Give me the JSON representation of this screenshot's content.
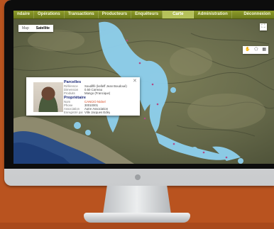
{
  "nav": {
    "items": [
      "ndaire",
      "Opérations",
      "Transactions",
      "Producteurs",
      "Enquêteurs",
      "Carte",
      "Administration"
    ],
    "active_index": 5,
    "logout": "Déconnexion"
  },
  "map_controls": {
    "map_label": "Map",
    "satellite_label": "Satellite",
    "selected": "Satellite",
    "fullscreen_icon": "fullscreen-icon",
    "tool_icons": [
      "pan-hand-icon",
      "polygon-draw-icon",
      "grid-icon"
    ]
  },
  "colors": {
    "nav_bg": "#7d8b23",
    "nav_active": "#b5c15a",
    "parcel_marker": "#8ed0ee",
    "info_title": "#1d2a7a",
    "link": "#d6451c"
  },
  "info_window": {
    "parcels_title": "Parcelles",
    "parcels_rows": [
      {
        "k": "Référence",
        "v": "Soudiffé (kelleff Jean Boudoué)"
      },
      {
        "k": "Dimension",
        "v": "0.50 Carreau"
      },
      {
        "k": "Produits",
        "v": "Mango (Francique)"
      }
    ],
    "owner_title": "Propriétaire",
    "owner_rows": [
      {
        "k": "Nom",
        "v": "CANCIO Nickel"
      },
      {
        "k": "Phone",
        "v": "30010001"
      },
      {
        "k": "Association",
        "v": "Autre Association"
      },
      {
        "k": "Enregistré par",
        "v": "Ville Jacques Edèy"
      }
    ],
    "close_icon": "close-icon"
  }
}
